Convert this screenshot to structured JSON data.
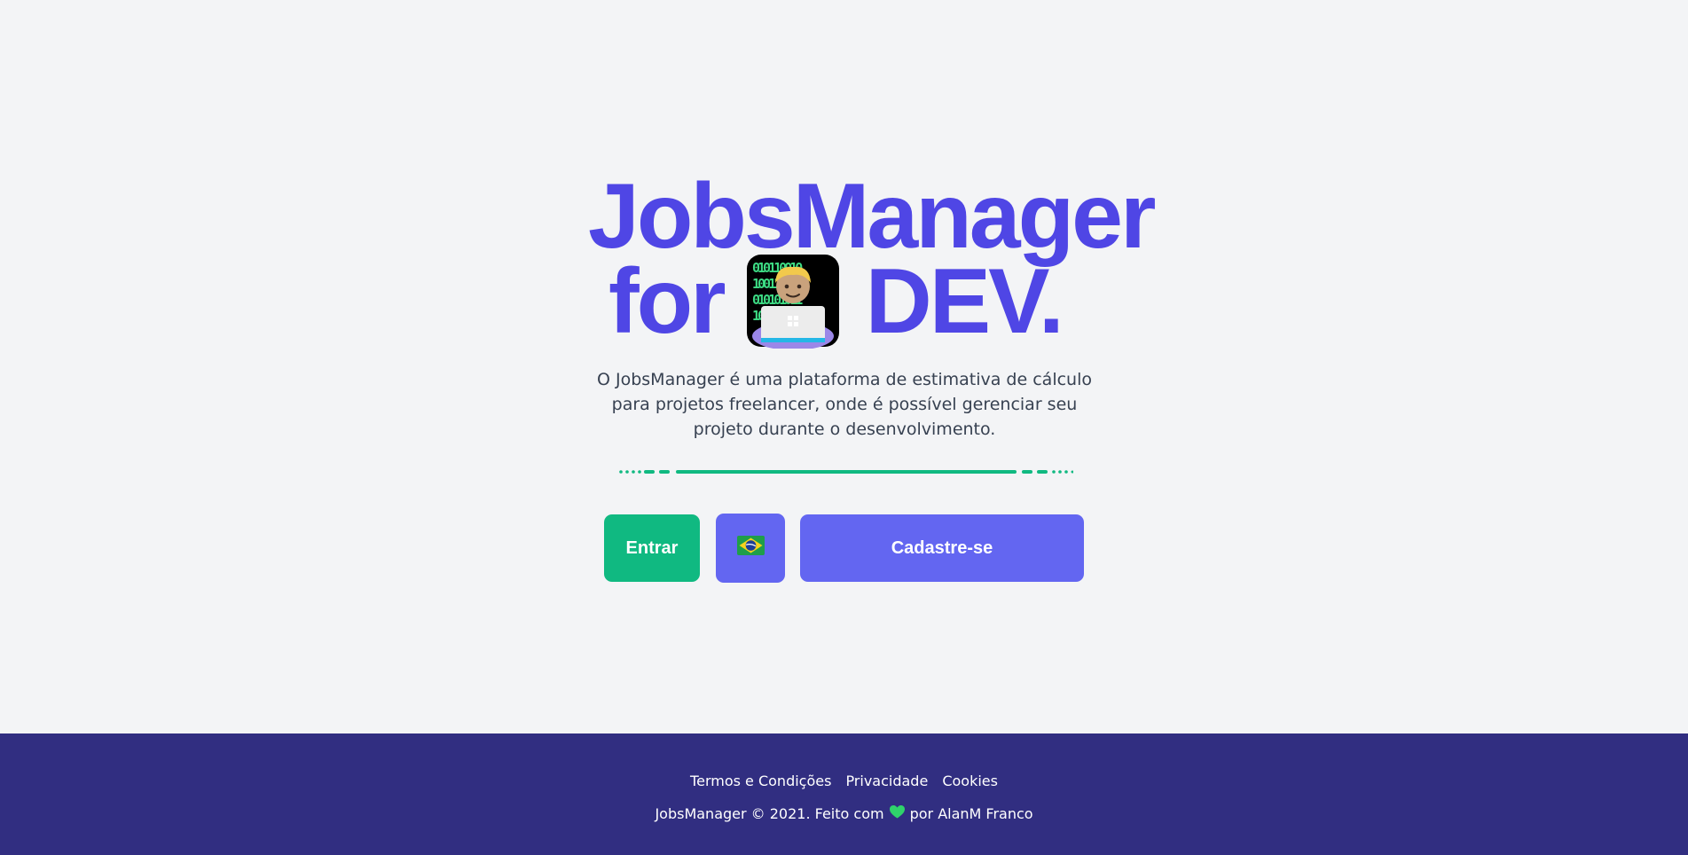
{
  "hero": {
    "title_line1": "JobsManager",
    "title_for": "for",
    "title_dev": "DEV.",
    "title_emoji": "technologist-emoji",
    "description": "O JobsManager é uma plataforma de estimativa de cálculo para projetos freelancer, onde é possível gerenciar seu projeto durante o desenvolvimento."
  },
  "actions": {
    "login_label": "Entrar",
    "language_icon": "brazil-flag-icon",
    "signup_label": "Cadastre-se"
  },
  "footer": {
    "links": [
      "Termos e Condições",
      "Privacidade",
      "Cookies"
    ],
    "copyright_before": "JobsManager © 2021. Feito com",
    "heart_icon": "green-heart-icon",
    "copyright_after": "por AlanM Franco"
  },
  "colors": {
    "background": "#f3f4f6",
    "primary": "#4f46e5",
    "button_primary": "#6366f1",
    "button_success": "#10b981",
    "footer": "#312e81",
    "divider": "#10b981"
  }
}
